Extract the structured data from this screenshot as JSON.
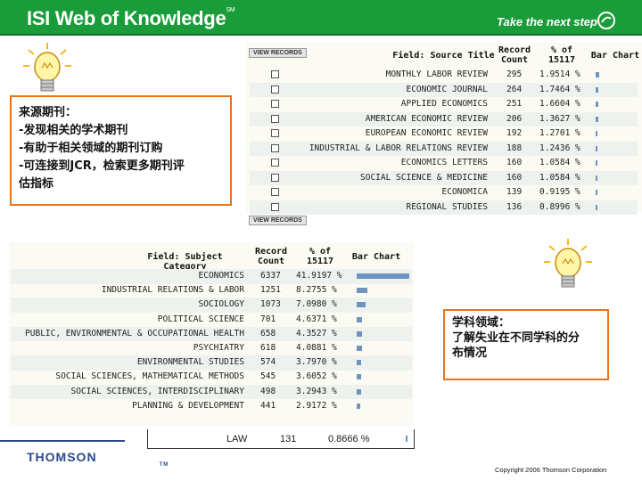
{
  "header": {
    "logo_text": "ISI Web of Knowledge",
    "logo_sup": "SM",
    "tagline": "Take the next step"
  },
  "callout_left": {
    "lines": [
      "来源期刊：",
      "-发现相关的学术期刊",
      "-有助于相关领域的期刊订购",
      "-可连接到JCR，检索更多期刊评",
      "估指标"
    ]
  },
  "callout_right": {
    "lines": [
      "学科领域：",
      "",
      "了解失业在不同学科的分",
      "布情况"
    ]
  },
  "source_table": {
    "view_records_label": "VIEW RECORDS",
    "headers": {
      "field": "Field: Source Title",
      "count": "Record Count",
      "pct": "% of 15117",
      "bar": "Bar Chart"
    },
    "rows": [
      {
        "title": "MONTHLY LABOR REVIEW",
        "count": "295",
        "pct": "1.9514 %",
        "bar": 0.0195
      },
      {
        "title": "ECONOMIC JOURNAL",
        "count": "264",
        "pct": "1.7464 %",
        "bar": 0.0175
      },
      {
        "title": "APPLIED ECONOMICS",
        "count": "251",
        "pct": "1.6604 %",
        "bar": 0.0166
      },
      {
        "title": "AMERICAN ECONOMIC REVIEW",
        "count": "206",
        "pct": "1.3627 %",
        "bar": 0.0136
      },
      {
        "title": "EUROPEAN ECONOMIC REVIEW",
        "count": "192",
        "pct": "1.2701 %",
        "bar": 0.0127
      },
      {
        "title": "INDUSTRIAL & LABOR RELATIONS REVIEW",
        "count": "188",
        "pct": "1.2436 %",
        "bar": 0.0124
      },
      {
        "title": "ECONOMICS LETTERS",
        "count": "160",
        "pct": "1.0584 %",
        "bar": 0.0106
      },
      {
        "title": "SOCIAL SCIENCE & MEDICINE",
        "count": "160",
        "pct": "1.0584 %",
        "bar": 0.0106
      },
      {
        "title": "ECONOMICA",
        "count": "139",
        "pct": "0.9195 %",
        "bar": 0.0092
      },
      {
        "title": "REGIONAL STUDIES",
        "count": "136",
        "pct": "0.8996 %",
        "bar": 0.009
      }
    ]
  },
  "subject_table": {
    "headers": {
      "field": "Field: Subject Category",
      "count": "Record Count",
      "pct": "% of 15117",
      "bar": "Bar Chart"
    },
    "rows": [
      {
        "title": "ECONOMICS",
        "count": "6337",
        "pct": "41.9197 %",
        "bar": 0.419
      },
      {
        "title": "INDUSTRIAL RELATIONS & LABOR",
        "count": "1251",
        "pct": "8.2755 %",
        "bar": 0.0828
      },
      {
        "title": "SOCIOLOGY",
        "count": "1073",
        "pct": "7.0980 %",
        "bar": 0.071
      },
      {
        "title": "POLITICAL SCIENCE",
        "count": "701",
        "pct": "4.6371 %",
        "bar": 0.0464
      },
      {
        "title": "PUBLIC, ENVIRONMENTAL & OCCUPATIONAL HEALTH",
        "count": "658",
        "pct": "4.3527 %",
        "bar": 0.0435
      },
      {
        "title": "PSYCHIATRY",
        "count": "618",
        "pct": "4.0881 %",
        "bar": 0.0409
      },
      {
        "title": "ENVIRONMENTAL STUDIES",
        "count": "574",
        "pct": "3.7970 %",
        "bar": 0.038
      },
      {
        "title": "SOCIAL SCIENCES, MATHEMATICAL METHODS",
        "count": "545",
        "pct": "3.6052 %",
        "bar": 0.0361
      },
      {
        "title": "SOCIAL SCIENCES, INTERDISCIPLINARY",
        "count": "498",
        "pct": "3.2943 %",
        "bar": 0.0329
      },
      {
        "title": "PLANNING & DEVELOPMENT",
        "count": "441",
        "pct": "2.9172 %",
        "bar": 0.0292
      }
    ],
    "extra_row": {
      "title": "LAW",
      "count": "131",
      "pct": "0.8666 %",
      "bar": 0.0087
    }
  },
  "footer": {
    "brand": "THOMSON",
    "brand_tm": "TM",
    "copyright": "Copyright 2006 Thomson Corporation"
  },
  "colors": {
    "header_green": "#1a9c3a",
    "callout_border": "#e8731c",
    "bar_blue": "#6f93c0",
    "brand_blue": "#2a4a8c"
  },
  "icons": [
    "lightbulb-icon",
    "swirl-logo-icon",
    "checkbox-icon"
  ]
}
